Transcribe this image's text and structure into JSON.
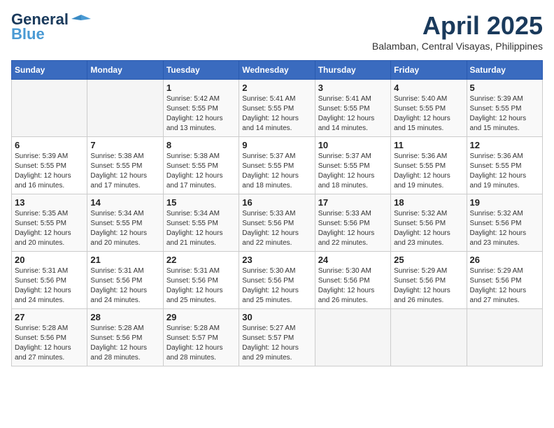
{
  "logo": {
    "line1": "General",
    "line2": "Blue"
  },
  "title": "April 2025",
  "location": "Balamban, Central Visayas, Philippines",
  "weekdays": [
    "Sunday",
    "Monday",
    "Tuesday",
    "Wednesday",
    "Thursday",
    "Friday",
    "Saturday"
  ],
  "weeks": [
    [
      {
        "day": "",
        "info": ""
      },
      {
        "day": "",
        "info": ""
      },
      {
        "day": "1",
        "info": "Sunrise: 5:42 AM\nSunset: 5:55 PM\nDaylight: 12 hours\nand 13 minutes."
      },
      {
        "day": "2",
        "info": "Sunrise: 5:41 AM\nSunset: 5:55 PM\nDaylight: 12 hours\nand 14 minutes."
      },
      {
        "day": "3",
        "info": "Sunrise: 5:41 AM\nSunset: 5:55 PM\nDaylight: 12 hours\nand 14 minutes."
      },
      {
        "day": "4",
        "info": "Sunrise: 5:40 AM\nSunset: 5:55 PM\nDaylight: 12 hours\nand 15 minutes."
      },
      {
        "day": "5",
        "info": "Sunrise: 5:39 AM\nSunset: 5:55 PM\nDaylight: 12 hours\nand 15 minutes."
      }
    ],
    [
      {
        "day": "6",
        "info": "Sunrise: 5:39 AM\nSunset: 5:55 PM\nDaylight: 12 hours\nand 16 minutes."
      },
      {
        "day": "7",
        "info": "Sunrise: 5:38 AM\nSunset: 5:55 PM\nDaylight: 12 hours\nand 17 minutes."
      },
      {
        "day": "8",
        "info": "Sunrise: 5:38 AM\nSunset: 5:55 PM\nDaylight: 12 hours\nand 17 minutes."
      },
      {
        "day": "9",
        "info": "Sunrise: 5:37 AM\nSunset: 5:55 PM\nDaylight: 12 hours\nand 18 minutes."
      },
      {
        "day": "10",
        "info": "Sunrise: 5:37 AM\nSunset: 5:55 PM\nDaylight: 12 hours\nand 18 minutes."
      },
      {
        "day": "11",
        "info": "Sunrise: 5:36 AM\nSunset: 5:55 PM\nDaylight: 12 hours\nand 19 minutes."
      },
      {
        "day": "12",
        "info": "Sunrise: 5:36 AM\nSunset: 5:55 PM\nDaylight: 12 hours\nand 19 minutes."
      }
    ],
    [
      {
        "day": "13",
        "info": "Sunrise: 5:35 AM\nSunset: 5:55 PM\nDaylight: 12 hours\nand 20 minutes."
      },
      {
        "day": "14",
        "info": "Sunrise: 5:34 AM\nSunset: 5:55 PM\nDaylight: 12 hours\nand 20 minutes."
      },
      {
        "day": "15",
        "info": "Sunrise: 5:34 AM\nSunset: 5:55 PM\nDaylight: 12 hours\nand 21 minutes."
      },
      {
        "day": "16",
        "info": "Sunrise: 5:33 AM\nSunset: 5:56 PM\nDaylight: 12 hours\nand 22 minutes."
      },
      {
        "day": "17",
        "info": "Sunrise: 5:33 AM\nSunset: 5:56 PM\nDaylight: 12 hours\nand 22 minutes."
      },
      {
        "day": "18",
        "info": "Sunrise: 5:32 AM\nSunset: 5:56 PM\nDaylight: 12 hours\nand 23 minutes."
      },
      {
        "day": "19",
        "info": "Sunrise: 5:32 AM\nSunset: 5:56 PM\nDaylight: 12 hours\nand 23 minutes."
      }
    ],
    [
      {
        "day": "20",
        "info": "Sunrise: 5:31 AM\nSunset: 5:56 PM\nDaylight: 12 hours\nand 24 minutes."
      },
      {
        "day": "21",
        "info": "Sunrise: 5:31 AM\nSunset: 5:56 PM\nDaylight: 12 hours\nand 24 minutes."
      },
      {
        "day": "22",
        "info": "Sunrise: 5:31 AM\nSunset: 5:56 PM\nDaylight: 12 hours\nand 25 minutes."
      },
      {
        "day": "23",
        "info": "Sunrise: 5:30 AM\nSunset: 5:56 PM\nDaylight: 12 hours\nand 25 minutes."
      },
      {
        "day": "24",
        "info": "Sunrise: 5:30 AM\nSunset: 5:56 PM\nDaylight: 12 hours\nand 26 minutes."
      },
      {
        "day": "25",
        "info": "Sunrise: 5:29 AM\nSunset: 5:56 PM\nDaylight: 12 hours\nand 26 minutes."
      },
      {
        "day": "26",
        "info": "Sunrise: 5:29 AM\nSunset: 5:56 PM\nDaylight: 12 hours\nand 27 minutes."
      }
    ],
    [
      {
        "day": "27",
        "info": "Sunrise: 5:28 AM\nSunset: 5:56 PM\nDaylight: 12 hours\nand 27 minutes."
      },
      {
        "day": "28",
        "info": "Sunrise: 5:28 AM\nSunset: 5:56 PM\nDaylight: 12 hours\nand 28 minutes."
      },
      {
        "day": "29",
        "info": "Sunrise: 5:28 AM\nSunset: 5:57 PM\nDaylight: 12 hours\nand 28 minutes."
      },
      {
        "day": "30",
        "info": "Sunrise: 5:27 AM\nSunset: 5:57 PM\nDaylight: 12 hours\nand 29 minutes."
      },
      {
        "day": "",
        "info": ""
      },
      {
        "day": "",
        "info": ""
      },
      {
        "day": "",
        "info": ""
      }
    ]
  ]
}
